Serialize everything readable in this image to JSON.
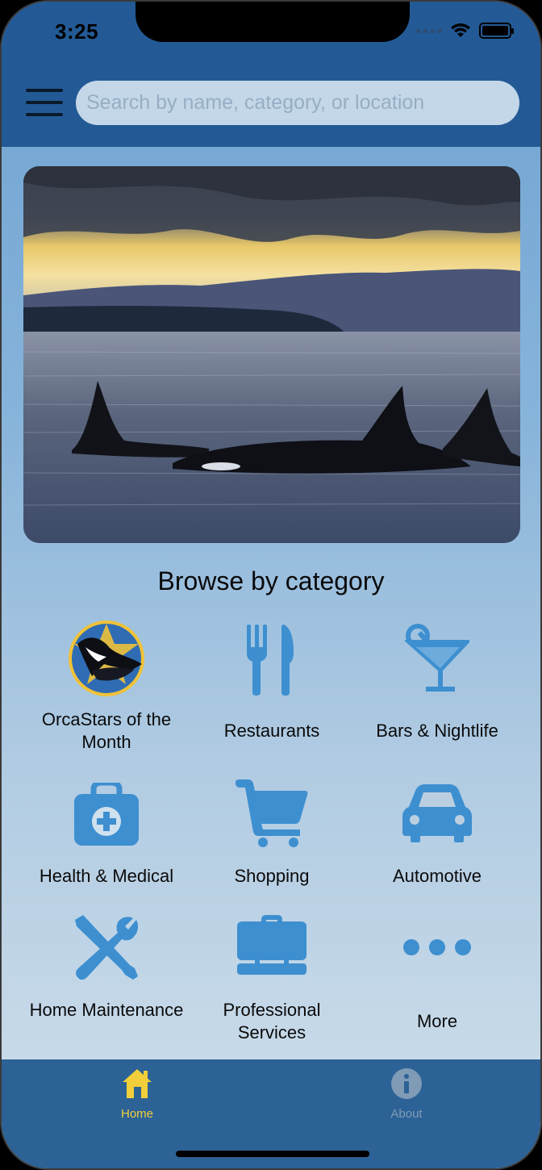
{
  "status_bar": {
    "time": "3:25"
  },
  "search": {
    "placeholder": "Search by name, category, or location"
  },
  "section": {
    "title": "Browse by category"
  },
  "categories": [
    {
      "label": "OrcaStars of the Month",
      "icon": "orcastars-badge-icon"
    },
    {
      "label": "Restaurants",
      "icon": "fork-knife-icon"
    },
    {
      "label": "Bars & Nightlife",
      "icon": "cocktail-icon"
    },
    {
      "label": "Health & Medical",
      "icon": "medical-bag-icon"
    },
    {
      "label": "Shopping",
      "icon": "shopping-cart-icon"
    },
    {
      "label": "Automotive",
      "icon": "car-icon"
    },
    {
      "label": "Home Maintenance",
      "icon": "tools-icon"
    },
    {
      "label": "Professional Services",
      "icon": "briefcase-icon"
    },
    {
      "label": "More",
      "icon": "more-dots-icon"
    }
  ],
  "tabs": [
    {
      "label": "Home",
      "icon": "home-icon",
      "active": true
    },
    {
      "label": "About",
      "icon": "info-icon",
      "active": false
    }
  ],
  "colors": {
    "header": "#235a96",
    "icon_blue": "#3d8fd0",
    "tab_active": "#f2cf3a",
    "tab_inactive": "#7f9bb5",
    "tabbar": "#2c6296"
  }
}
